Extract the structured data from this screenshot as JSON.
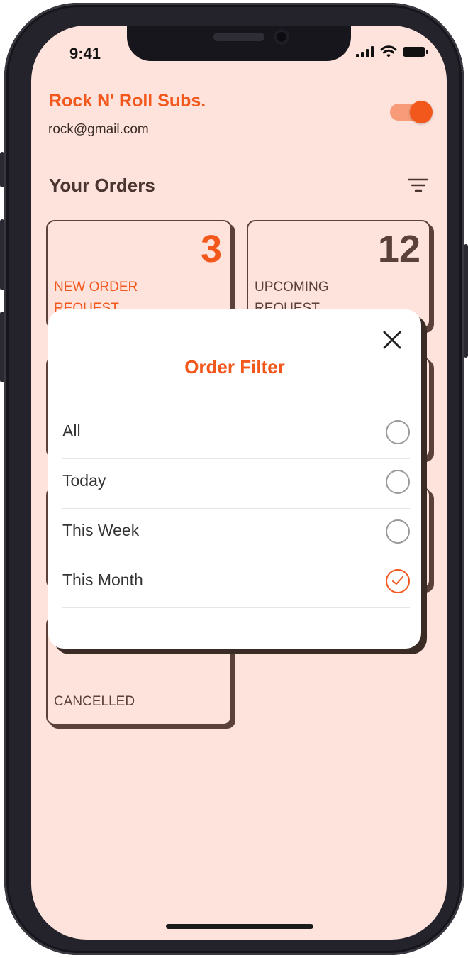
{
  "status": {
    "time": "9:41"
  },
  "header": {
    "title": "Rock N' Roll Subs.",
    "email": "rock@gmail.com"
  },
  "orders": {
    "title": "Your Orders",
    "cards": [
      {
        "count": "3",
        "label": "NEW ORDER REQUEST"
      },
      {
        "count": "12",
        "label": "UPCOMING REQUEST"
      },
      {
        "label": "CANCELLED"
      }
    ]
  },
  "filter_modal": {
    "title": "Order Filter",
    "options": [
      {
        "label": "All",
        "selected": false
      },
      {
        "label": "Today",
        "selected": false
      },
      {
        "label": "This Week",
        "selected": false
      },
      {
        "label": "This Month",
        "selected": true
      }
    ]
  },
  "colors": {
    "accent": "#f2571c",
    "background": "#fde3dc",
    "dark": "#5a413a"
  }
}
